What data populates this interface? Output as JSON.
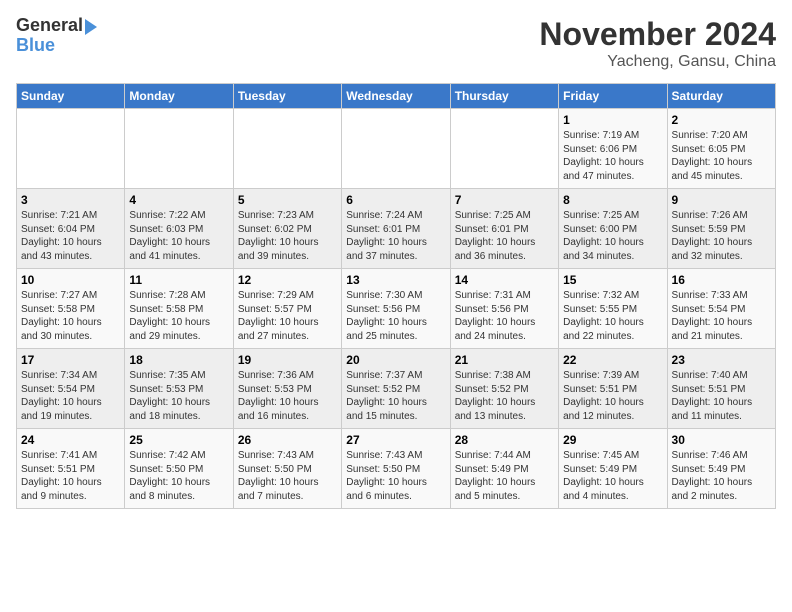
{
  "header": {
    "logo_line1": "General",
    "logo_line2": "Blue",
    "month_title": "November 2024",
    "location": "Yacheng, Gansu, China"
  },
  "weekdays": [
    "Sunday",
    "Monday",
    "Tuesday",
    "Wednesday",
    "Thursday",
    "Friday",
    "Saturday"
  ],
  "weeks": [
    [
      {
        "day": "",
        "sunrise": "",
        "sunset": "",
        "daylight": ""
      },
      {
        "day": "",
        "sunrise": "",
        "sunset": "",
        "daylight": ""
      },
      {
        "day": "",
        "sunrise": "",
        "sunset": "",
        "daylight": ""
      },
      {
        "day": "",
        "sunrise": "",
        "sunset": "",
        "daylight": ""
      },
      {
        "day": "",
        "sunrise": "",
        "sunset": "",
        "daylight": ""
      },
      {
        "day": "1",
        "sunrise": "Sunrise: 7:19 AM",
        "sunset": "Sunset: 6:06 PM",
        "daylight": "Daylight: 10 hours and 47 minutes."
      },
      {
        "day": "2",
        "sunrise": "Sunrise: 7:20 AM",
        "sunset": "Sunset: 6:05 PM",
        "daylight": "Daylight: 10 hours and 45 minutes."
      }
    ],
    [
      {
        "day": "3",
        "sunrise": "Sunrise: 7:21 AM",
        "sunset": "Sunset: 6:04 PM",
        "daylight": "Daylight: 10 hours and 43 minutes."
      },
      {
        "day": "4",
        "sunrise": "Sunrise: 7:22 AM",
        "sunset": "Sunset: 6:03 PM",
        "daylight": "Daylight: 10 hours and 41 minutes."
      },
      {
        "day": "5",
        "sunrise": "Sunrise: 7:23 AM",
        "sunset": "Sunset: 6:02 PM",
        "daylight": "Daylight: 10 hours and 39 minutes."
      },
      {
        "day": "6",
        "sunrise": "Sunrise: 7:24 AM",
        "sunset": "Sunset: 6:01 PM",
        "daylight": "Daylight: 10 hours and 37 minutes."
      },
      {
        "day": "7",
        "sunrise": "Sunrise: 7:25 AM",
        "sunset": "Sunset: 6:01 PM",
        "daylight": "Daylight: 10 hours and 36 minutes."
      },
      {
        "day": "8",
        "sunrise": "Sunrise: 7:25 AM",
        "sunset": "Sunset: 6:00 PM",
        "daylight": "Daylight: 10 hours and 34 minutes."
      },
      {
        "day": "9",
        "sunrise": "Sunrise: 7:26 AM",
        "sunset": "Sunset: 5:59 PM",
        "daylight": "Daylight: 10 hours and 32 minutes."
      }
    ],
    [
      {
        "day": "10",
        "sunrise": "Sunrise: 7:27 AM",
        "sunset": "Sunset: 5:58 PM",
        "daylight": "Daylight: 10 hours and 30 minutes."
      },
      {
        "day": "11",
        "sunrise": "Sunrise: 7:28 AM",
        "sunset": "Sunset: 5:58 PM",
        "daylight": "Daylight: 10 hours and 29 minutes."
      },
      {
        "day": "12",
        "sunrise": "Sunrise: 7:29 AM",
        "sunset": "Sunset: 5:57 PM",
        "daylight": "Daylight: 10 hours and 27 minutes."
      },
      {
        "day": "13",
        "sunrise": "Sunrise: 7:30 AM",
        "sunset": "Sunset: 5:56 PM",
        "daylight": "Daylight: 10 hours and 25 minutes."
      },
      {
        "day": "14",
        "sunrise": "Sunrise: 7:31 AM",
        "sunset": "Sunset: 5:56 PM",
        "daylight": "Daylight: 10 hours and 24 minutes."
      },
      {
        "day": "15",
        "sunrise": "Sunrise: 7:32 AM",
        "sunset": "Sunset: 5:55 PM",
        "daylight": "Daylight: 10 hours and 22 minutes."
      },
      {
        "day": "16",
        "sunrise": "Sunrise: 7:33 AM",
        "sunset": "Sunset: 5:54 PM",
        "daylight": "Daylight: 10 hours and 21 minutes."
      }
    ],
    [
      {
        "day": "17",
        "sunrise": "Sunrise: 7:34 AM",
        "sunset": "Sunset: 5:54 PM",
        "daylight": "Daylight: 10 hours and 19 minutes."
      },
      {
        "day": "18",
        "sunrise": "Sunrise: 7:35 AM",
        "sunset": "Sunset: 5:53 PM",
        "daylight": "Daylight: 10 hours and 18 minutes."
      },
      {
        "day": "19",
        "sunrise": "Sunrise: 7:36 AM",
        "sunset": "Sunset: 5:53 PM",
        "daylight": "Daylight: 10 hours and 16 minutes."
      },
      {
        "day": "20",
        "sunrise": "Sunrise: 7:37 AM",
        "sunset": "Sunset: 5:52 PM",
        "daylight": "Daylight: 10 hours and 15 minutes."
      },
      {
        "day": "21",
        "sunrise": "Sunrise: 7:38 AM",
        "sunset": "Sunset: 5:52 PM",
        "daylight": "Daylight: 10 hours and 13 minutes."
      },
      {
        "day": "22",
        "sunrise": "Sunrise: 7:39 AM",
        "sunset": "Sunset: 5:51 PM",
        "daylight": "Daylight: 10 hours and 12 minutes."
      },
      {
        "day": "23",
        "sunrise": "Sunrise: 7:40 AM",
        "sunset": "Sunset: 5:51 PM",
        "daylight": "Daylight: 10 hours and 11 minutes."
      }
    ],
    [
      {
        "day": "24",
        "sunrise": "Sunrise: 7:41 AM",
        "sunset": "Sunset: 5:51 PM",
        "daylight": "Daylight: 10 hours and 9 minutes."
      },
      {
        "day": "25",
        "sunrise": "Sunrise: 7:42 AM",
        "sunset": "Sunset: 5:50 PM",
        "daylight": "Daylight: 10 hours and 8 minutes."
      },
      {
        "day": "26",
        "sunrise": "Sunrise: 7:43 AM",
        "sunset": "Sunset: 5:50 PM",
        "daylight": "Daylight: 10 hours and 7 minutes."
      },
      {
        "day": "27",
        "sunrise": "Sunrise: 7:43 AM",
        "sunset": "Sunset: 5:50 PM",
        "daylight": "Daylight: 10 hours and 6 minutes."
      },
      {
        "day": "28",
        "sunrise": "Sunrise: 7:44 AM",
        "sunset": "Sunset: 5:49 PM",
        "daylight": "Daylight: 10 hours and 5 minutes."
      },
      {
        "day": "29",
        "sunrise": "Sunrise: 7:45 AM",
        "sunset": "Sunset: 5:49 PM",
        "daylight": "Daylight: 10 hours and 4 minutes."
      },
      {
        "day": "30",
        "sunrise": "Sunrise: 7:46 AM",
        "sunset": "Sunset: 5:49 PM",
        "daylight": "Daylight: 10 hours and 2 minutes."
      }
    ]
  ]
}
